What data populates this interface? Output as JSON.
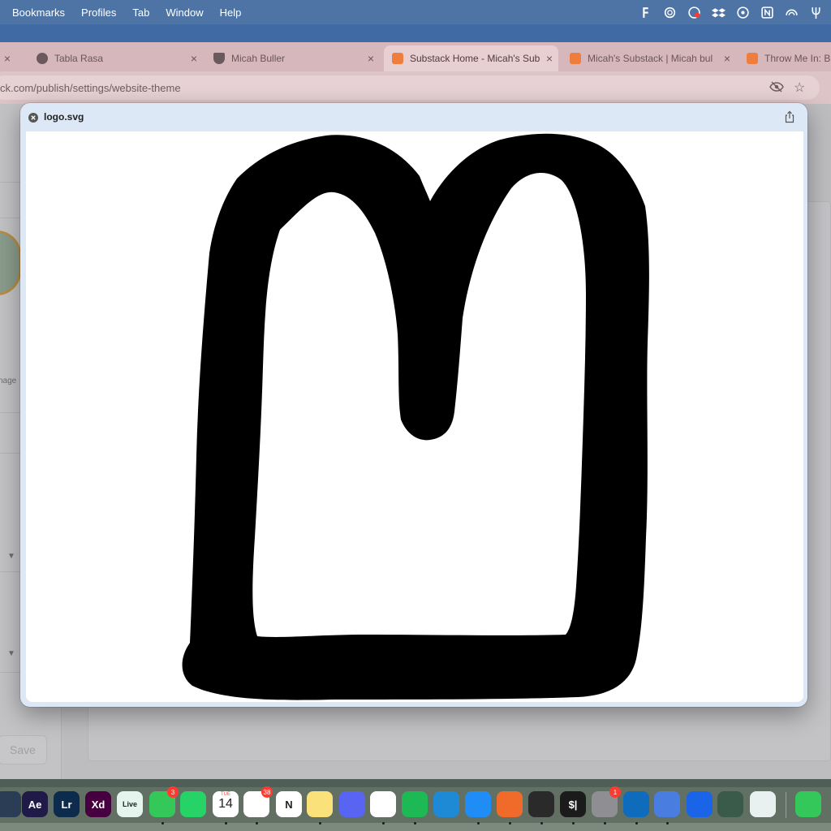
{
  "menubar": {
    "items": [
      "Bookmarks",
      "Profiles",
      "Tab",
      "Window",
      "Help"
    ],
    "status_icons": [
      "fantastical-icon",
      "chatgpt-icon",
      "screen-record-icon",
      "dropbox-icon",
      "focus-icon",
      "notion-icon",
      "wifi-arc-icon",
      "pitchfork-icon"
    ]
  },
  "tabs": [
    {
      "title": "Tabla Rasa",
      "icon": "lock-favicon",
      "color": "#6b5a5d",
      "active": false
    },
    {
      "title": "Micah Buller",
      "icon": "shield-favicon",
      "color": "#6b5a5d",
      "active": false
    },
    {
      "title": "Substack Home - Micah's Sub",
      "icon": "substack-favicon",
      "color": "#ef7d3e",
      "active": true
    },
    {
      "title": "Micah's Substack | Micah bul",
      "icon": "substack-favicon",
      "color": "#ef7d3e",
      "active": false
    },
    {
      "title": "Throw Me In: Bra",
      "icon": "substack-favicon",
      "color": "#ef7d3e",
      "active": false
    }
  ],
  "address_bar": {
    "url": "ck.com/publish/settings/website-theme"
  },
  "background_page": {
    "partial_label": "nage",
    "save_label": "Save"
  },
  "quicklook": {
    "filename": "logo.svg",
    "accent": "#dde8f6"
  },
  "dock": {
    "apps": [
      {
        "name": "davinci-resolve-icon",
        "label": "",
        "color": "#2b3d55"
      },
      {
        "name": "after-effects-icon",
        "label": "Ae",
        "color": "#1f1a47"
      },
      {
        "name": "lightroom-icon",
        "label": "Lr",
        "color": "#0d2b4c"
      },
      {
        "name": "adobe-xd-icon",
        "label": "Xd",
        "color": "#46003f"
      },
      {
        "name": "live-icon",
        "label": "Live",
        "color": "#e6f4ee"
      },
      {
        "name": "messages-icon",
        "label": "",
        "color": "#34c759",
        "badge": "3"
      },
      {
        "name": "whatsapp-icon",
        "label": "",
        "color": "#25d366"
      },
      {
        "name": "calendar-icon",
        "label": "14",
        "color": "#ffffff",
        "sub": "TUE"
      },
      {
        "name": "reminders-icon",
        "label": "",
        "color": "#ffffff",
        "badge": "38"
      },
      {
        "name": "notion-icon",
        "label": "N",
        "color": "#ffffff"
      },
      {
        "name": "notes-icon",
        "label": "",
        "color": "#fbe17a"
      },
      {
        "name": "discord-icon",
        "label": "",
        "color": "#5865f2"
      },
      {
        "name": "slack-icon",
        "label": "",
        "color": "#ffffff"
      },
      {
        "name": "spotify-icon",
        "label": "",
        "color": "#1db954"
      },
      {
        "name": "vscode-icon",
        "label": "",
        "color": "#1e8ad6"
      },
      {
        "name": "app-store-icon",
        "label": "",
        "color": "#1f8df5"
      },
      {
        "name": "pen-tool-icon",
        "label": "",
        "color": "#f06a2a"
      },
      {
        "name": "linear-icon",
        "label": "",
        "color": "#2a2a2a"
      },
      {
        "name": "terminal-icon",
        "label": "$|",
        "color": "#1b1b1b"
      },
      {
        "name": "system-settings-icon",
        "label": "",
        "color": "#8e8e93",
        "badge": "1"
      },
      {
        "name": "outlook-icon",
        "label": "",
        "color": "#0f6cbd"
      },
      {
        "name": "simulator-icon",
        "label": "",
        "color": "#4a7de0"
      },
      {
        "name": "1password-icon",
        "label": "",
        "color": "#1a64e8"
      },
      {
        "name": "cursor-icon",
        "label": "",
        "color": "#3a5a4a"
      },
      {
        "name": "creative-cloud-icon",
        "label": "",
        "color": "#e8f0f0"
      },
      {
        "name": "phone-icon",
        "label": "",
        "color": "#34c759"
      }
    ]
  }
}
